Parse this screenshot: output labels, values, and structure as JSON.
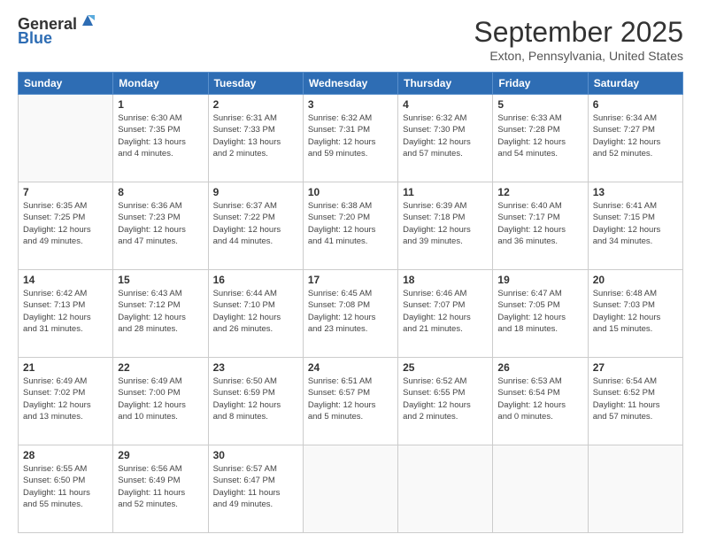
{
  "logo": {
    "general": "General",
    "blue": "Blue"
  },
  "header": {
    "month": "September 2025",
    "location": "Exton, Pennsylvania, United States"
  },
  "columns": [
    "Sunday",
    "Monday",
    "Tuesday",
    "Wednesday",
    "Thursday",
    "Friday",
    "Saturday"
  ],
  "weeks": [
    [
      {
        "day": "",
        "info": ""
      },
      {
        "day": "1",
        "info": "Sunrise: 6:30 AM\nSunset: 7:35 PM\nDaylight: 13 hours\nand 4 minutes."
      },
      {
        "day": "2",
        "info": "Sunrise: 6:31 AM\nSunset: 7:33 PM\nDaylight: 13 hours\nand 2 minutes."
      },
      {
        "day": "3",
        "info": "Sunrise: 6:32 AM\nSunset: 7:31 PM\nDaylight: 12 hours\nand 59 minutes."
      },
      {
        "day": "4",
        "info": "Sunrise: 6:32 AM\nSunset: 7:30 PM\nDaylight: 12 hours\nand 57 minutes."
      },
      {
        "day": "5",
        "info": "Sunrise: 6:33 AM\nSunset: 7:28 PM\nDaylight: 12 hours\nand 54 minutes."
      },
      {
        "day": "6",
        "info": "Sunrise: 6:34 AM\nSunset: 7:27 PM\nDaylight: 12 hours\nand 52 minutes."
      }
    ],
    [
      {
        "day": "7",
        "info": "Sunrise: 6:35 AM\nSunset: 7:25 PM\nDaylight: 12 hours\nand 49 minutes."
      },
      {
        "day": "8",
        "info": "Sunrise: 6:36 AM\nSunset: 7:23 PM\nDaylight: 12 hours\nand 47 minutes."
      },
      {
        "day": "9",
        "info": "Sunrise: 6:37 AM\nSunset: 7:22 PM\nDaylight: 12 hours\nand 44 minutes."
      },
      {
        "day": "10",
        "info": "Sunrise: 6:38 AM\nSunset: 7:20 PM\nDaylight: 12 hours\nand 41 minutes."
      },
      {
        "day": "11",
        "info": "Sunrise: 6:39 AM\nSunset: 7:18 PM\nDaylight: 12 hours\nand 39 minutes."
      },
      {
        "day": "12",
        "info": "Sunrise: 6:40 AM\nSunset: 7:17 PM\nDaylight: 12 hours\nand 36 minutes."
      },
      {
        "day": "13",
        "info": "Sunrise: 6:41 AM\nSunset: 7:15 PM\nDaylight: 12 hours\nand 34 minutes."
      }
    ],
    [
      {
        "day": "14",
        "info": "Sunrise: 6:42 AM\nSunset: 7:13 PM\nDaylight: 12 hours\nand 31 minutes."
      },
      {
        "day": "15",
        "info": "Sunrise: 6:43 AM\nSunset: 7:12 PM\nDaylight: 12 hours\nand 28 minutes."
      },
      {
        "day": "16",
        "info": "Sunrise: 6:44 AM\nSunset: 7:10 PM\nDaylight: 12 hours\nand 26 minutes."
      },
      {
        "day": "17",
        "info": "Sunrise: 6:45 AM\nSunset: 7:08 PM\nDaylight: 12 hours\nand 23 minutes."
      },
      {
        "day": "18",
        "info": "Sunrise: 6:46 AM\nSunset: 7:07 PM\nDaylight: 12 hours\nand 21 minutes."
      },
      {
        "day": "19",
        "info": "Sunrise: 6:47 AM\nSunset: 7:05 PM\nDaylight: 12 hours\nand 18 minutes."
      },
      {
        "day": "20",
        "info": "Sunrise: 6:48 AM\nSunset: 7:03 PM\nDaylight: 12 hours\nand 15 minutes."
      }
    ],
    [
      {
        "day": "21",
        "info": "Sunrise: 6:49 AM\nSunset: 7:02 PM\nDaylight: 12 hours\nand 13 minutes."
      },
      {
        "day": "22",
        "info": "Sunrise: 6:49 AM\nSunset: 7:00 PM\nDaylight: 12 hours\nand 10 minutes."
      },
      {
        "day": "23",
        "info": "Sunrise: 6:50 AM\nSunset: 6:59 PM\nDaylight: 12 hours\nand 8 minutes."
      },
      {
        "day": "24",
        "info": "Sunrise: 6:51 AM\nSunset: 6:57 PM\nDaylight: 12 hours\nand 5 minutes."
      },
      {
        "day": "25",
        "info": "Sunrise: 6:52 AM\nSunset: 6:55 PM\nDaylight: 12 hours\nand 2 minutes."
      },
      {
        "day": "26",
        "info": "Sunrise: 6:53 AM\nSunset: 6:54 PM\nDaylight: 12 hours\nand 0 minutes."
      },
      {
        "day": "27",
        "info": "Sunrise: 6:54 AM\nSunset: 6:52 PM\nDaylight: 11 hours\nand 57 minutes."
      }
    ],
    [
      {
        "day": "28",
        "info": "Sunrise: 6:55 AM\nSunset: 6:50 PM\nDaylight: 11 hours\nand 55 minutes."
      },
      {
        "day": "29",
        "info": "Sunrise: 6:56 AM\nSunset: 6:49 PM\nDaylight: 11 hours\nand 52 minutes."
      },
      {
        "day": "30",
        "info": "Sunrise: 6:57 AM\nSunset: 6:47 PM\nDaylight: 11 hours\nand 49 minutes."
      },
      {
        "day": "",
        "info": ""
      },
      {
        "day": "",
        "info": ""
      },
      {
        "day": "",
        "info": ""
      },
      {
        "day": "",
        "info": ""
      }
    ]
  ]
}
